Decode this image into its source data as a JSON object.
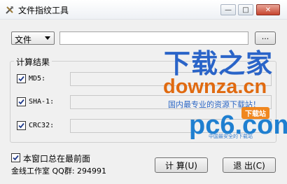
{
  "window": {
    "title": "文件指纹工具"
  },
  "file_select": {
    "selected": "文件"
  },
  "path_input": {
    "value": ""
  },
  "browse_button": {
    "label": "..."
  },
  "results": {
    "group_label": "计算结果",
    "rows": [
      {
        "label": "MD5:",
        "checked": true,
        "value": ""
      },
      {
        "label": "SHA-1:",
        "checked": true,
        "value": ""
      },
      {
        "label": "CRC32:",
        "checked": true,
        "value": ""
      }
    ]
  },
  "always_on_top": {
    "label": "本窗口总在最前面",
    "checked": true
  },
  "footer": {
    "text": "金线工作室   QQ群: 294991"
  },
  "buttons": {
    "calculate": "计 算(U)",
    "exit": "退 出(C)"
  },
  "watermark": {
    "site1_title": "下载之家",
    "site1_domain": "downza.cn",
    "site1_slogan": "国内最专业的资源下载站！",
    "site2_domain": "pc6.com",
    "site2_badge": "下载站",
    "site2_slogan": "中国最安全的下载站"
  },
  "colors": {
    "window_bg": "#f0f0f0",
    "close_button": "#c6452f",
    "watermark_blue": "#2a64c8",
    "watermark_orange": "#e06a10"
  }
}
